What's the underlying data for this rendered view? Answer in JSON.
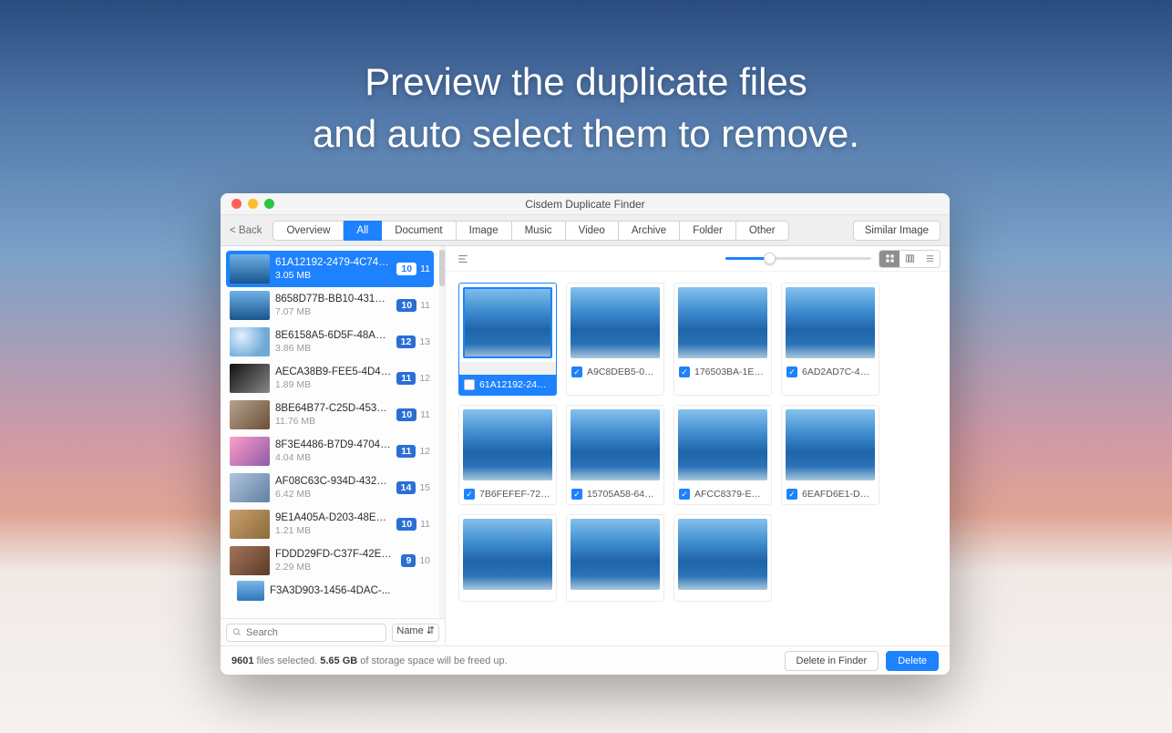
{
  "headline_line1": "Preview the duplicate files",
  "headline_line2": "and auto select them to remove.",
  "window_title": "Cisdem Duplicate Finder",
  "back_label": "< Back",
  "tabs": [
    "Overview",
    "All",
    "Document",
    "Image",
    "Music",
    "Video",
    "Archive",
    "Folder",
    "Other"
  ],
  "active_tab_index": 1,
  "similar_button": "Similar Image",
  "groups": [
    {
      "name": "61A12192-2479-4C74-B...",
      "size": "3.05 MB",
      "c1": "10",
      "c2": "11",
      "cls": "v1",
      "sel": true
    },
    {
      "name": "8658D77B-BB10-431B-...",
      "size": "7.07 MB",
      "c1": "10",
      "c2": "11",
      "cls": "v1"
    },
    {
      "name": "8E6158A5-6D5F-48A3-...",
      "size": "3.86 MB",
      "c1": "12",
      "c2": "13",
      "cls": "v2"
    },
    {
      "name": "AECA38B9-FEE5-4D40-...",
      "size": "1.89 MB",
      "c1": "11",
      "c2": "12",
      "cls": "v3"
    },
    {
      "name": "8BE64B77-C25D-453D-...",
      "size": "11.76 MB",
      "c1": "10",
      "c2": "11",
      "cls": "v4"
    },
    {
      "name": "8F3E4486-B7D9-4704-...",
      "size": "4.04 MB",
      "c1": "11",
      "c2": "12",
      "cls": "v5"
    },
    {
      "name": "AF08C63C-934D-4329-...",
      "size": "6.42 MB",
      "c1": "14",
      "c2": "15",
      "cls": "v6"
    },
    {
      "name": "9E1A405A-D203-48E0-...",
      "size": "1.21 MB",
      "c1": "10",
      "c2": "11",
      "cls": "v7"
    },
    {
      "name": "FDDD29FD-C37F-42EF-...",
      "size": "2.29 MB",
      "c1": "9",
      "c2": "10",
      "cls": "v8"
    },
    {
      "name": "F3A3D903-1456-4DAC-...",
      "size": "",
      "c1": "",
      "c2": "",
      "cls": "v9",
      "short": true
    }
  ],
  "search_placeholder": "Search",
  "sort_label": "Name ⇵",
  "thumbnails": [
    {
      "name": "61A12192-2479-4...",
      "checked": false,
      "selected": true
    },
    {
      "name": "A9C8DEB5-04F2-...",
      "checked": true
    },
    {
      "name": "176503BA-1EC3-4...",
      "checked": true
    },
    {
      "name": "6AD2AD7C-4CC0-...",
      "checked": true
    },
    {
      "name": "7B6FEFEF-7244-4...",
      "checked": true
    },
    {
      "name": "15705A58-649B-4...",
      "checked": true
    },
    {
      "name": "AFCC8379-EA4E-...",
      "checked": true
    },
    {
      "name": "6EAFD6E1-DF39-4...",
      "checked": true
    },
    {
      "name": "",
      "checked": true,
      "nolabel": true
    },
    {
      "name": "",
      "checked": true,
      "nolabel": true
    },
    {
      "name": "",
      "checked": true,
      "nolabel": true
    }
  ],
  "footer": {
    "count": "9601",
    "t1": " files selected. ",
    "size": "5.65 GB",
    "t2": " of storage space will be freed up.",
    "delete_finder": "Delete in Finder",
    "delete": "Delete"
  }
}
